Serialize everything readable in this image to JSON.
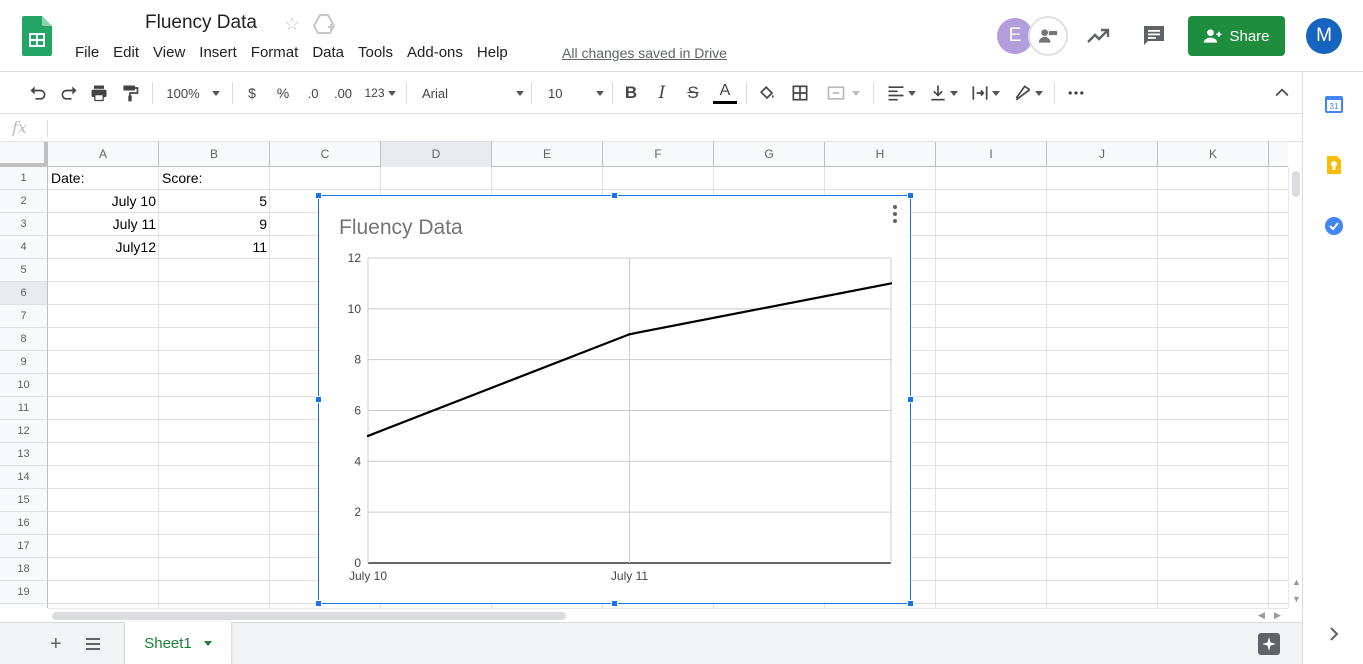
{
  "app": {
    "title": "Fluency Data",
    "saved_status": "All changes saved in Drive",
    "share_label": "Share",
    "collaborator_initial": "E",
    "user_initial": "M"
  },
  "menu": [
    "File",
    "Edit",
    "View",
    "Insert",
    "Format",
    "Data",
    "Tools",
    "Add-ons",
    "Help"
  ],
  "toolbar": {
    "zoom": "100%",
    "currency": "$",
    "percent": "%",
    "decrease_decimal": ".0",
    "increase_decimal": ".00",
    "more_formats": "123",
    "font": "Arial",
    "font_size": "10"
  },
  "formula_bar": {
    "label": "fx"
  },
  "columns": [
    "A",
    "B",
    "C",
    "D",
    "E",
    "F",
    "G",
    "H",
    "I",
    "J",
    "K"
  ],
  "rows": [
    "1",
    "2",
    "3",
    "4",
    "5",
    "6",
    "7",
    "8",
    "9",
    "10",
    "11",
    "12",
    "13",
    "14",
    "15",
    "16",
    "17",
    "18",
    "19"
  ],
  "cells": {
    "A1": "Date:",
    "B1": "Score:",
    "A2": "July 10",
    "B2": "5",
    "A3": "July 11",
    "B3": "9",
    "A4": "July12",
    "B4": "11"
  },
  "sheet": {
    "tab_name": "Sheet1"
  },
  "colors": {
    "accent_green": "#1e8e3e",
    "selection_blue": "#1a73e8",
    "line": "#000000"
  },
  "chart_data": {
    "type": "line",
    "title": "Fluency Data",
    "categories": [
      "July 10",
      "July 11",
      "July12"
    ],
    "tick_labels_x": [
      "July 10",
      "July 11"
    ],
    "series": [
      {
        "values": [
          5,
          9,
          11
        ]
      }
    ],
    "ylim": [
      0,
      12
    ],
    "yticks": [
      "0",
      "2",
      "4",
      "6",
      "8",
      "10",
      "12"
    ],
    "grid": true
  }
}
